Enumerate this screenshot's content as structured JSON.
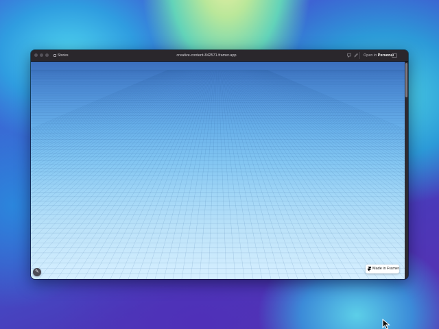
{
  "desktop": {
    "wallpaper_colors": [
      "#3f6ad8",
      "#62d3b9",
      "#f2f0a6",
      "#4f30b8"
    ]
  },
  "browser": {
    "tab_label": "Stories",
    "url": "creative-content-842571.framer.app",
    "open_in": {
      "prefix": "Open in",
      "workspace": "Personal"
    },
    "icons": {
      "tab": "tab-square-icon",
      "reader": "comment-icon",
      "extension": "pen-icon",
      "profile": "workspace-badge-icon"
    }
  },
  "page": {
    "background_colors": [
      "#3b6fbe",
      "#80c4f1",
      "#d6efff"
    ],
    "edit_button_icon": "pencil-icon",
    "made_in_framer": {
      "label": "Made in Framer",
      "icon": "framer-logo-icon"
    }
  }
}
